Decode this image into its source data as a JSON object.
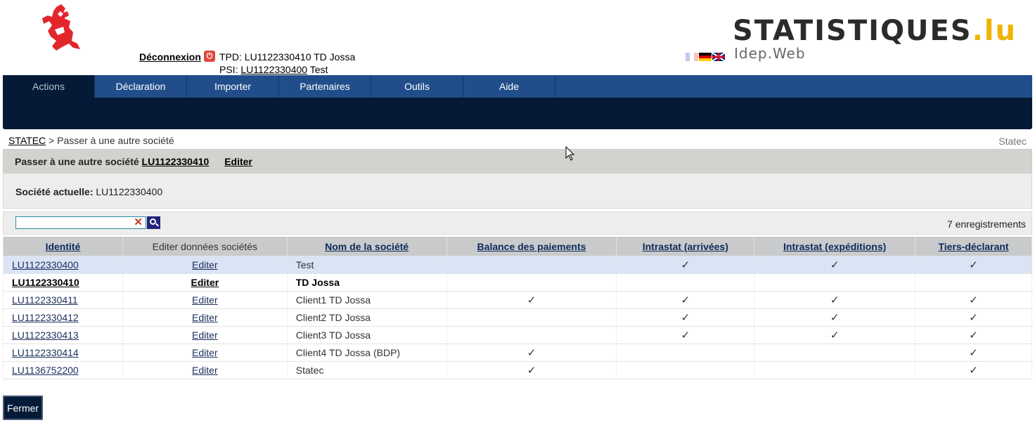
{
  "header": {
    "brand_main": "STATISTIQUES",
    "brand_tld": ".lu",
    "brand_sub": "Idep.Web",
    "logout": "Déconnexion",
    "tpd": "TPD: LU1122330410 TD Jossa",
    "psi_prefix": "PSI:",
    "psi_link": "LU1122330400",
    "psi_suffix": "Test",
    "flags": [
      "fr-flag-icon",
      "de-flag-icon",
      "gb-flag-icon"
    ]
  },
  "nav": {
    "tabs": [
      "Actions",
      "Déclaration",
      "Importer",
      "Partenaires",
      "Outils",
      "Aide"
    ],
    "active": "Actions"
  },
  "breadcrumb": {
    "root": "STATEC",
    "separator": ">",
    "current": "Passer à une autre société",
    "right": "Statec"
  },
  "panel": {
    "title": "Passer à une autre société",
    "title_link": "LU1122330410",
    "edit_link": "Editer",
    "current_label": "Société actuelle:",
    "current_value": "LU1122330400"
  },
  "search": {
    "value": "",
    "clear": "✕",
    "count": "7 enregistrements"
  },
  "table": {
    "headers": [
      "Identité",
      "Editer données sociétés",
      "Nom de la société",
      "Balance des paiements",
      "Intrastat (arrivées)",
      "Intrastat (expéditions)",
      "Tiers-déclarant"
    ],
    "rows": [
      {
        "id": "LU1122330400",
        "edit": "Editer",
        "name": "Test",
        "bdp": "",
        "arr": "✓",
        "exp": "✓",
        "tiers": "✓"
      },
      {
        "id": "LU1122330410",
        "edit": "Editer",
        "name": "TD Jossa",
        "bdp": "",
        "arr": "",
        "exp": "",
        "tiers": ""
      },
      {
        "id": "LU1122330411",
        "edit": "Editer",
        "name": "Client1 TD Jossa",
        "bdp": "✓",
        "arr": "✓",
        "exp": "✓",
        "tiers": "✓"
      },
      {
        "id": "LU1122330412",
        "edit": "Editer",
        "name": "Client2 TD Jossa",
        "bdp": "",
        "arr": "✓",
        "exp": "✓",
        "tiers": "✓"
      },
      {
        "id": "LU1122330413",
        "edit": "Editer",
        "name": "Client3 TD Jossa",
        "bdp": "",
        "arr": "✓",
        "exp": "✓",
        "tiers": "✓"
      },
      {
        "id": "LU1122330414",
        "edit": "Editer",
        "name": "Client4 TD Jossa (BDP)",
        "bdp": "✓",
        "arr": "",
        "exp": "",
        "tiers": "✓"
      },
      {
        "id": "LU1136752200",
        "edit": "Editer",
        "name": "Statec",
        "bdp": "✓",
        "arr": "",
        "exp": "",
        "tiers": "✓"
      }
    ]
  },
  "footer": {
    "close_button": "Fermer"
  },
  "colors": {
    "nav_dark": "#041a37",
    "nav_bar": "#214e8a",
    "selected_row": "#dae4f5",
    "brand_accent": "#f0b400",
    "logout_icon": "#e0463c"
  }
}
